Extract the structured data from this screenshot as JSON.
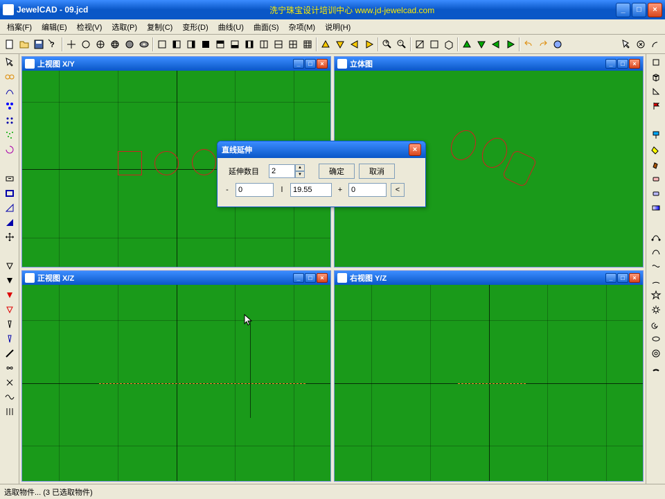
{
  "app": {
    "title": "JewelCAD - 09.jcd",
    "header_banner": "洗宁珠宝设计培训中心   www.jd-jewelcad.com"
  },
  "menu": {
    "items": [
      "档案(F)",
      "编辑(E)",
      "检视(V)",
      "选取(P)",
      "复制(C)",
      "变形(D)",
      "曲线(U)",
      "曲面(S)",
      "杂项(M)",
      "说明(H)"
    ]
  },
  "viewports": {
    "top_left": "上视图  X/Y",
    "top_right": "立体图",
    "bottom_left": "正视图  X/Z",
    "bottom_right": "右视图  Y/Z"
  },
  "dialog": {
    "title": "直线延伸",
    "extend_label": "延伸数目",
    "extend_value": "2",
    "ok_label": "确定",
    "cancel_label": "取消",
    "minus_label": "-",
    "minus_value": "0",
    "length_label": "l",
    "length_value": "19.55",
    "plus_label": "+",
    "plus_value": "0",
    "arrow_label": "<"
  },
  "status": {
    "text": "选取物件...  (3 已选取物件)"
  },
  "chart_data": null
}
